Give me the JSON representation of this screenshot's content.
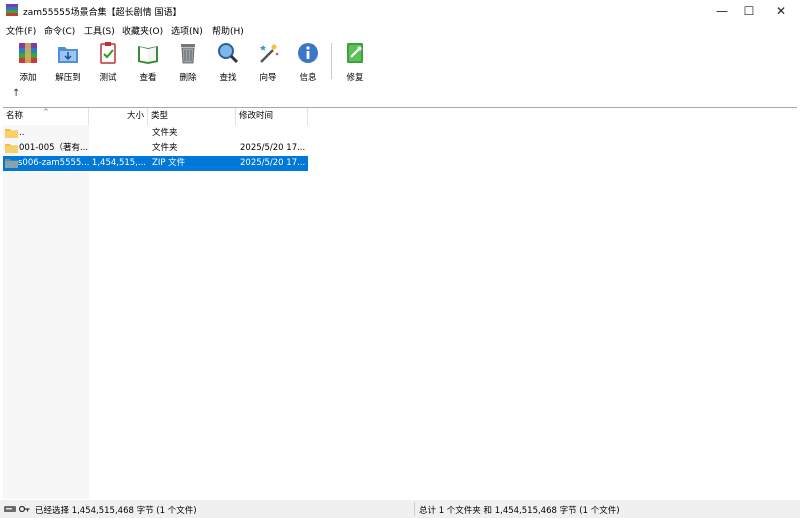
{
  "window": {
    "title": "zam55555场景合集【超长剧情 国语】",
    "minimize_glyph": "—",
    "maximize_glyph": "☐",
    "close_glyph": "✕"
  },
  "menu": [
    "文件(F)",
    "命令(C)",
    "工具(S)",
    "收藏夹(O)",
    "选项(N)",
    "帮助(H)"
  ],
  "toolbar": [
    {
      "label": "添加",
      "icon": "add-archive-icon"
    },
    {
      "label": "解压到",
      "icon": "extract-to-icon"
    },
    {
      "label": "测试",
      "icon": "test-icon"
    },
    {
      "label": "查看",
      "icon": "view-icon"
    },
    {
      "label": "删除",
      "icon": "delete-icon"
    },
    {
      "label": "查找",
      "icon": "find-icon"
    },
    {
      "label": "向导",
      "icon": "wizard-icon"
    },
    {
      "label": "信息",
      "icon": "info-icon"
    },
    {
      "label": "修复",
      "icon": "repair-icon"
    }
  ],
  "nav": {
    "up_glyph": "↑"
  },
  "columns": {
    "name": "名称",
    "size": "大小",
    "type": "类型",
    "modified": "修改时间",
    "sort_glyph": "^"
  },
  "files": [
    {
      "name": "..",
      "size": "",
      "type": "文件夹",
      "modified": "",
      "icon": "parent-folder-icon",
      "selected": false
    },
    {
      "name": "001-005（著有...",
      "size": "",
      "type": "文件夹",
      "modified": "2025/5/20 17...",
      "icon": "folder-icon",
      "selected": false
    },
    {
      "name": "s006-zam5555...",
      "size": "1,454,515,...",
      "type": "ZIP 文件",
      "modified": "2025/5/20 17...",
      "icon": "zip-folder-icon",
      "selected": true
    }
  ],
  "status": {
    "left": "已经选择 1,454,515,468 字节 (1 个文件)",
    "right": "总计 1 个文件夹 和 1,454,515,468 字节 (1 个文件)"
  },
  "colors": {
    "selection": "#0078d7",
    "folder": "#f5c042",
    "zip_folder": "#8aa3a8"
  }
}
